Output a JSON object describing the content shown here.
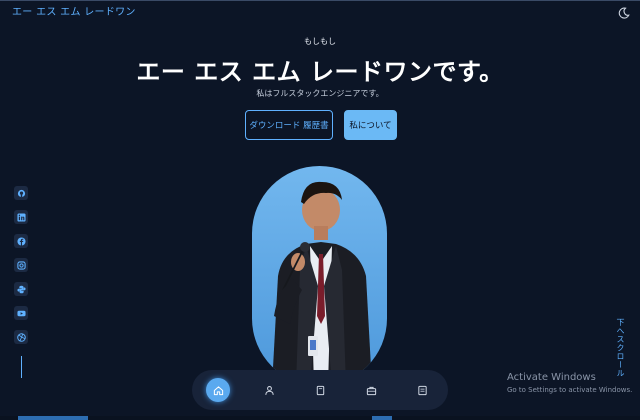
{
  "header": {
    "brand": "エー エス エム レードワン",
    "theme_icon": "moon-icon"
  },
  "hero": {
    "greeting": "もしもし",
    "title": "エー エス エム レードワンです。",
    "subtitle": "私はフルスタックエンジニアです。",
    "buttons": {
      "download_cv": "ダウンロード 履歴書",
      "about_me": "私について"
    }
  },
  "socials": [
    {
      "name": "github",
      "icon": "github-icon"
    },
    {
      "name": "linkedin",
      "icon": "linkedin-icon"
    },
    {
      "name": "facebook",
      "icon": "facebook-icon"
    },
    {
      "name": "instagram",
      "icon": "instagram-icon"
    },
    {
      "name": "python",
      "icon": "python-icon"
    },
    {
      "name": "youtube",
      "icon": "youtube-icon"
    },
    {
      "name": "dribbble",
      "icon": "dribbble-icon"
    }
  ],
  "scroll_down": "下へスクロール",
  "bottom_nav": {
    "items": [
      {
        "name": "home",
        "icon": "home-icon",
        "active": true
      },
      {
        "name": "about",
        "icon": "user-icon",
        "active": false
      },
      {
        "name": "resume",
        "icon": "book-icon",
        "active": false
      },
      {
        "name": "portfolio",
        "icon": "briefcase-icon",
        "active": false
      },
      {
        "name": "contact",
        "icon": "message-icon",
        "active": false
      }
    ]
  },
  "os_watermark": {
    "line1": "Activate Windows",
    "line2": "Go to Settings to activate Windows."
  },
  "colors": {
    "background": "#0c1526",
    "accent": "#5fb1ff",
    "button_fill": "#6bb9f5",
    "nav_bg": "#182339"
  }
}
